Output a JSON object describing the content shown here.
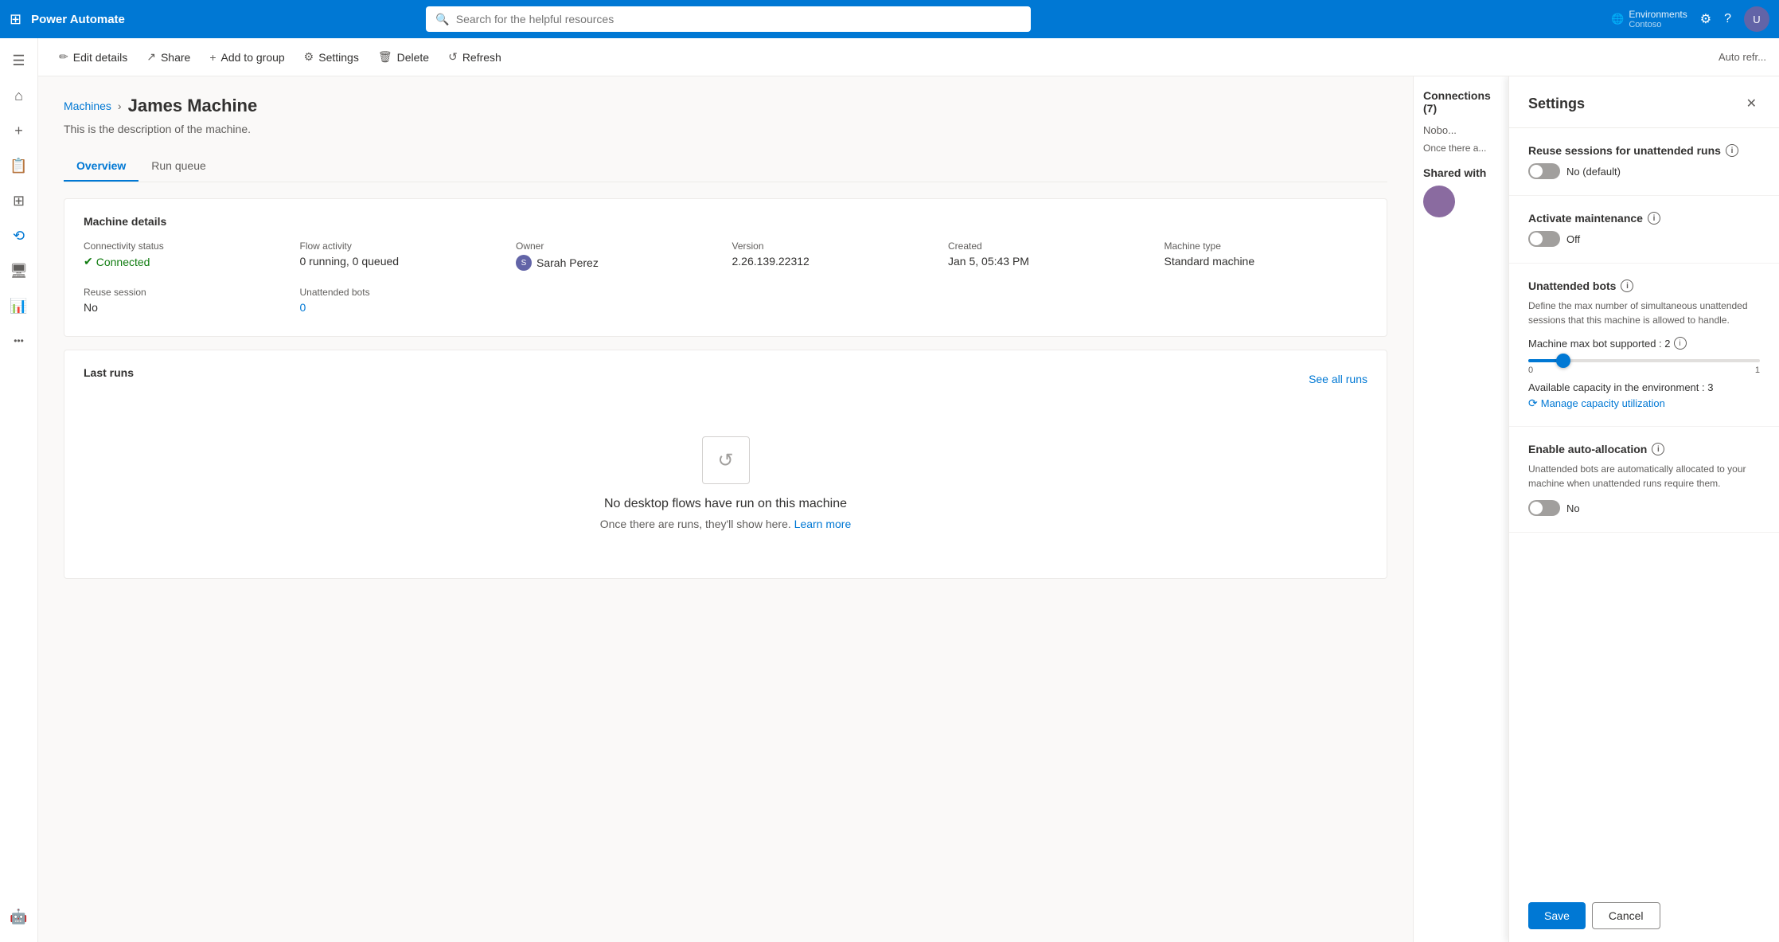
{
  "app": {
    "title": "Power Automate",
    "search_placeholder": "Search for the helpful resources"
  },
  "nav": {
    "environment_label": "Environments",
    "environment_name": "Contoso"
  },
  "toolbar": {
    "edit_label": "Edit details",
    "share_label": "Share",
    "add_group_label": "Add to group",
    "settings_label": "Settings",
    "delete_label": "Delete",
    "refresh_label": "Refresh",
    "auto_refresh_label": "Auto refr..."
  },
  "breadcrumb": {
    "parent": "Machines",
    "current": "James Machine"
  },
  "page": {
    "description": "This is the description of the machine."
  },
  "tabs": [
    {
      "label": "Overview",
      "active": true
    },
    {
      "label": "Run queue",
      "active": false
    }
  ],
  "machine_details": {
    "title": "Machine details",
    "connectivity_label": "Connectivity status",
    "connectivity_value": "Connected",
    "flow_activity_label": "Flow activity",
    "flow_activity_value": "0 running, 0 queued",
    "owner_label": "Owner",
    "owner_value": "Sarah Perez",
    "version_label": "Version",
    "version_value": "2.26.139.22312",
    "created_label": "Created",
    "created_value": "Jan 5, 05:43 PM",
    "machine_type_label": "Machine type",
    "machine_type_value": "Standard machine",
    "reuse_session_label": "Reuse session",
    "reuse_session_value": "No",
    "unattended_bots_label": "Unattended bots",
    "unattended_bots_value": "0"
  },
  "last_runs": {
    "title": "Last runs",
    "see_all": "See all runs",
    "empty_title": "No desktop flows have run on this machine",
    "empty_desc": "Once there are runs, they'll show here.",
    "learn_more": "Learn more"
  },
  "connections": {
    "title": "Connections (7)",
    "shared_with": "Shared with",
    "nobody_label": "Nobo..."
  },
  "settings_panel": {
    "title": "Settings",
    "reuse_sessions_label": "Reuse sessions for unattended runs",
    "reuse_sessions_value": "No (default)",
    "activate_maintenance_label": "Activate maintenance",
    "activate_maintenance_value": "Off",
    "unattended_bots_label": "Unattended bots",
    "unattended_bots_desc": "Define the max number of simultaneous unattended sessions that this machine is allowed to handle.",
    "machine_max_bot_label": "Machine max bot supported : 2",
    "slider_min": "0",
    "slider_max": "1",
    "available_capacity_label": "Available capacity in the environment : 3",
    "manage_capacity_label": "Manage capacity utilization",
    "auto_allocation_label": "Enable auto-allocation",
    "auto_allocation_desc": "Unattended bots are automatically allocated to your machine when unattended runs require them.",
    "auto_allocation_value": "No",
    "save_label": "Save",
    "cancel_label": "Cancel"
  },
  "sidebar": {
    "icons": [
      {
        "name": "home-icon",
        "symbol": "⌂"
      },
      {
        "name": "add-icon",
        "symbol": "+"
      },
      {
        "name": "book-icon",
        "symbol": "📖"
      },
      {
        "name": "grid-icon",
        "symbol": "⊞"
      },
      {
        "name": "connection-icon",
        "symbol": "⟳"
      },
      {
        "name": "monitor-icon",
        "symbol": "🖥"
      },
      {
        "name": "chart-icon",
        "symbol": "📊"
      },
      {
        "name": "more-icon",
        "symbol": "···"
      },
      {
        "name": "bot-icon",
        "symbol": "🤖"
      }
    ]
  }
}
